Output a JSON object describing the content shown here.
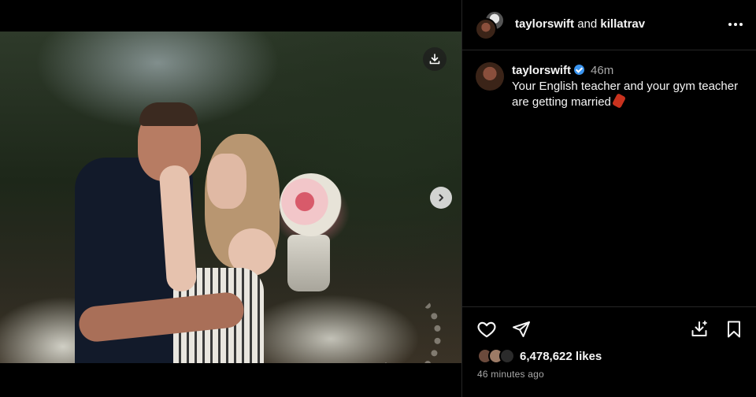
{
  "post": {
    "photo_count": 5,
    "active_photo_index": 1
  },
  "header": {
    "user1": "taylorswift",
    "joiner": "and",
    "user2": "killatrav"
  },
  "caption": {
    "username": "taylorswift",
    "time": "46m",
    "text": "Your English teacher and your gym teacher are getting married"
  },
  "likes": {
    "count_text": "6,478,622 likes"
  },
  "timestamp": "46 minutes ago",
  "icons": {
    "download": "download-icon",
    "next": "chevron-right-icon",
    "more": "more-icon",
    "like": "heart-icon",
    "share": "send-icon",
    "save_post": "save-download-icon",
    "bookmark": "bookmark-icon"
  },
  "colors": {
    "background": "#000000",
    "divider": "#262626",
    "verified": "#3b95f0",
    "muted_text": "#a8a8a8"
  }
}
